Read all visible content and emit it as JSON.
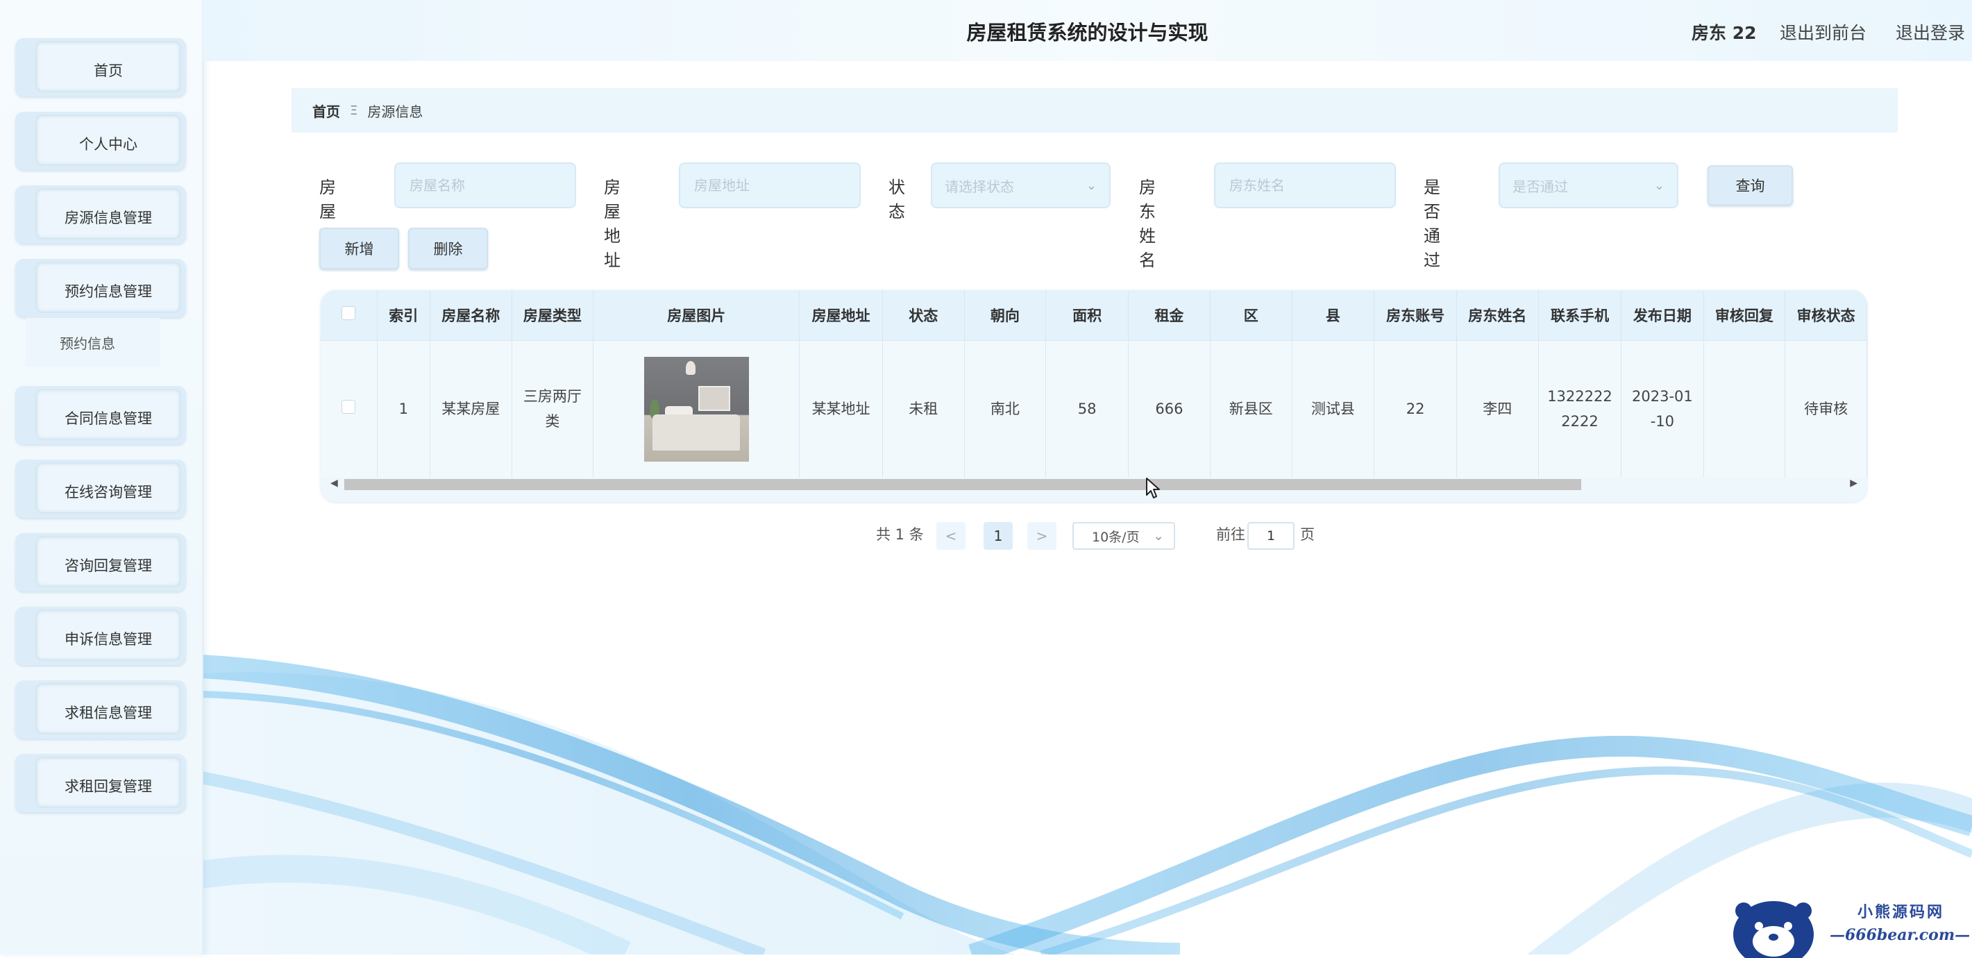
{
  "header": {
    "title": "房屋租赁系统的设计与实现",
    "user_label": "房东 22",
    "link_front": "退出到前台",
    "link_logout": "退出登录"
  },
  "sidebar": {
    "items": [
      {
        "label": "首页"
      },
      {
        "label": "个人中心"
      },
      {
        "label": "房源信息管理"
      },
      {
        "label": "预约信息管理"
      },
      {
        "label": "合同信息管理"
      },
      {
        "label": "在线咨询管理"
      },
      {
        "label": "咨询回复管理"
      },
      {
        "label": "申诉信息管理"
      },
      {
        "label": "求租信息管理"
      },
      {
        "label": "求租回复管理"
      }
    ],
    "subitem": {
      "label": "预约信息"
    }
  },
  "breadcrumb": {
    "home": "首页",
    "separator": "Ξ",
    "current": "房源信息"
  },
  "search": {
    "house_name": {
      "label": "房屋名称",
      "placeholder": "房屋名称",
      "value": ""
    },
    "house_address": {
      "label": "房屋地址",
      "placeholder": "房屋地址",
      "value": ""
    },
    "status": {
      "label": "状态",
      "placeholder": "请选择状态"
    },
    "landlord_name": {
      "label": "房东姓名",
      "placeholder": "房东姓名",
      "value": ""
    },
    "approved": {
      "label": "是否通过",
      "placeholder": "是否通过"
    },
    "query_button": "查询",
    "add_button": "新增",
    "delete_button": "删除"
  },
  "table": {
    "columns": [
      "",
      "索引",
      "房屋名称",
      "房屋类型",
      "房屋图片",
      "房屋地址",
      "状态",
      "朝向",
      "面积",
      "租金",
      "区",
      "县",
      "房东账号",
      "房东姓名",
      "联系手机",
      "发布日期",
      "审核回复",
      "审核状态"
    ],
    "rows": [
      {
        "index": "1",
        "name": "某某房屋",
        "type_line1": "三房两厅",
        "type_line2": "类",
        "address": "某某地址",
        "status": "未租",
        "orientation": "南北",
        "area": "58",
        "rent": "666",
        "district": "新县区",
        "county": "测试县",
        "landlord_account": "22",
        "landlord_name": "李四",
        "phone_line1": "1322222",
        "phone_line2": "2222",
        "date_line1": "2023-01",
        "date_line2": "-10",
        "review_reply": "",
        "review_status": "待审核"
      }
    ]
  },
  "pagination": {
    "total": "共 1 条",
    "prev": "<",
    "current_page": "1",
    "next": ">",
    "page_size": "10条/页",
    "goto_label": "前往",
    "goto_value": "1",
    "page_suffix": "页"
  },
  "watermark": {
    "line1": "小熊源码网",
    "line2": "—666bear.com—"
  },
  "colors": {
    "accent_light": "#eaf5fc",
    "button_bg": "#dcedf9",
    "wave_blue": "#2b9be0"
  }
}
